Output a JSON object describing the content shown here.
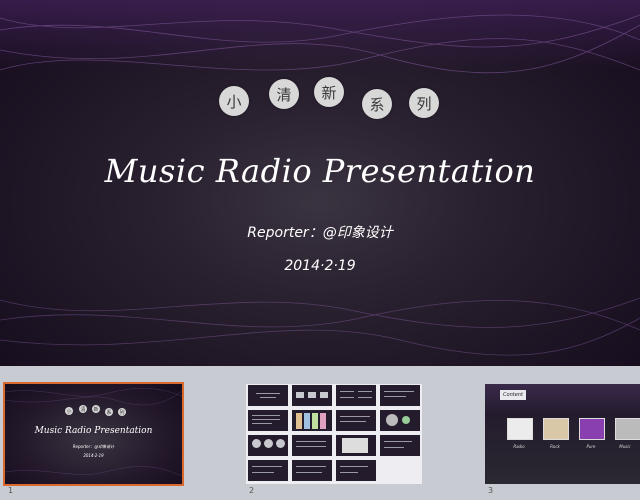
{
  "slide": {
    "series_chars": [
      "小",
      "清",
      "新",
      "系",
      "列"
    ],
    "title": "Music Radio Presentation",
    "reporter": "Reporter：@印象设计",
    "date": "2014·2·19"
  },
  "thumbnails": [
    {
      "number": "1",
      "selected": true,
      "series_chars": [
        "小",
        "清",
        "新",
        "系",
        "列"
      ],
      "title": "Music Radio Presentation",
      "reporter": "Reporter：@印象设计",
      "date": "2014·2·19"
    },
    {
      "number": "2",
      "selected": false
    },
    {
      "number": "3",
      "selected": false,
      "badge": "Content",
      "tile_labels": [
        "Radio",
        "Rock",
        "Pure",
        "Music"
      ]
    }
  ],
  "colors": {
    "slide_bg": "#1d1424",
    "strip_bg": "#c9cbd3",
    "selection": "#d9692c",
    "bubble": "#d8d8d8",
    "wave": "#8b5fa8"
  }
}
